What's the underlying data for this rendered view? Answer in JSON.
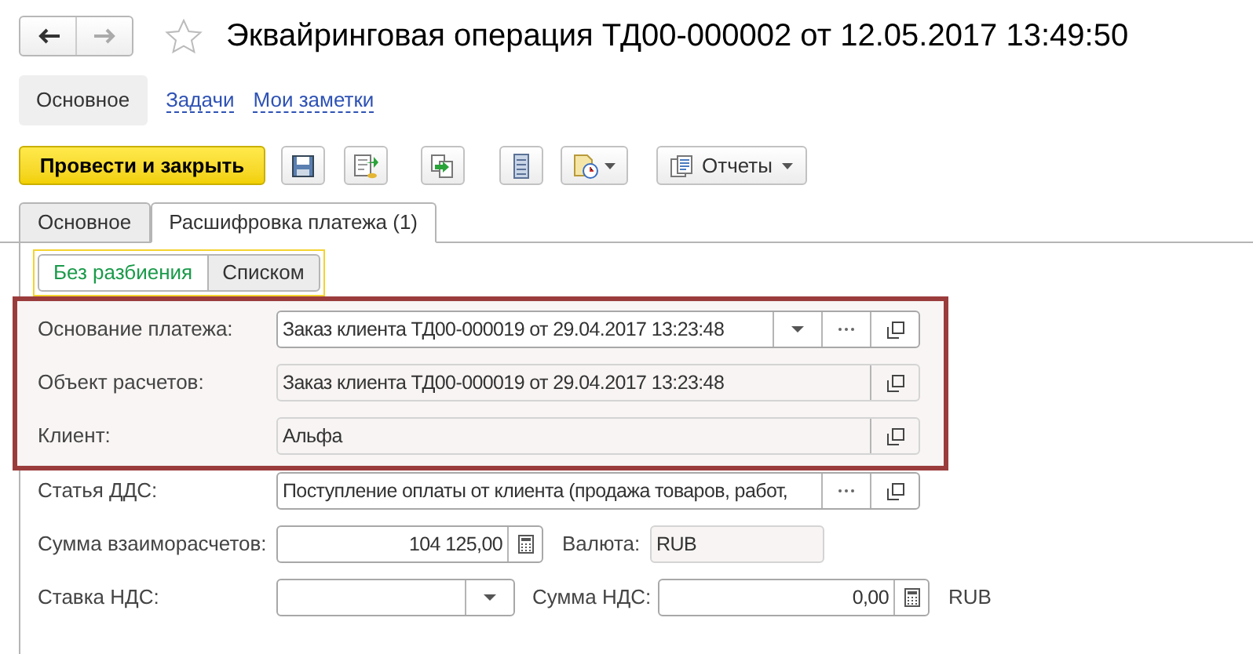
{
  "title": "Эквайринговая операция ТД00-000002 от 12.05.2017 13:49:50",
  "sections": [
    {
      "label": "Основное",
      "selected": true
    },
    {
      "label": "Задачи",
      "selected": false
    },
    {
      "label": "Мои заметки",
      "selected": false
    }
  ],
  "toolbar": {
    "primary": "Провести и закрыть",
    "reports": "Отчеты"
  },
  "tabs": [
    {
      "label": "Основное",
      "selected": false
    },
    {
      "label": "Расшифровка платежа (1)",
      "selected": true
    }
  ],
  "view_toggle": [
    {
      "label": "Без разбиения",
      "selected": true
    },
    {
      "label": "Списком",
      "selected": false
    }
  ],
  "highlighted_fields": [
    {
      "label": "Основание платежа:",
      "value": "Заказ клиента ТД00-000019 от 29.04.2017 13:23:48",
      "buttons": [
        {
          "kind": "dropdown"
        },
        {
          "kind": "select"
        },
        {
          "kind": "open"
        }
      ]
    },
    {
      "label": "Объект расчетов:",
      "value": "Заказ клиента ТД00-000019 от 29.04.2017 13:23:48",
      "buttons": [
        {
          "kind": "open"
        }
      ]
    },
    {
      "label": "Клиент:",
      "value": "Альфа",
      "buttons": [
        {
          "kind": "open"
        }
      ]
    }
  ],
  "cash_flow_item": {
    "label": "Статья ДДС:",
    "value": "Поступление оплаты от клиента (продажа товаров, работ,",
    "buttons": [
      {
        "kind": "select"
      },
      {
        "kind": "open"
      }
    ]
  },
  "settlement": {
    "label": "Сумма взаиморасчетов:",
    "value": "104 125,00",
    "currency_label": "Валюта:",
    "currency": "RUB"
  },
  "vat": {
    "rate_label": "Ставка НДС:",
    "amount_label": "Сумма НДС:",
    "amount": "0,00",
    "currency": "RUB"
  }
}
